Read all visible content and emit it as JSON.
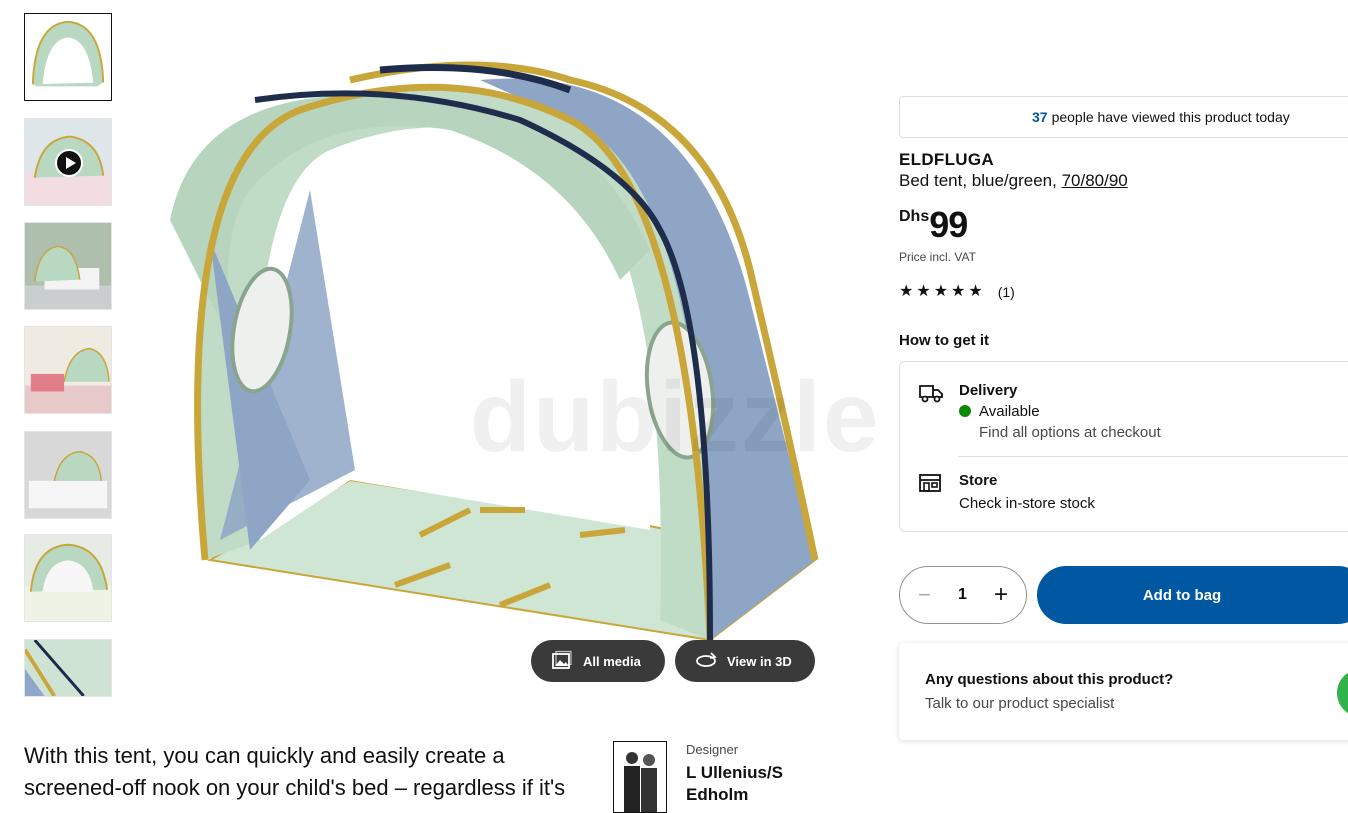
{
  "thumbnails": [
    {
      "label": "Tent product shot",
      "active": true
    },
    {
      "label": "Video",
      "video": true
    },
    {
      "label": "Bedroom scene"
    },
    {
      "label": "Child room"
    },
    {
      "label": "Bunk bed scene"
    },
    {
      "label": "Tent on bed"
    },
    {
      "label": "Detail"
    }
  ],
  "media": {
    "watermark": "dubizzle",
    "all_media_label": "All media",
    "view_3d_label": "View in 3D"
  },
  "description": "With this tent, you can quickly and easily create a screened-off nook on your child's bed – regardless if it's",
  "designer": {
    "label": "Designer",
    "name": "L Ullenius/S Edholm"
  },
  "viewers": {
    "count": "37",
    "text": "people have viewed this product today"
  },
  "product": {
    "name": "ELDFLUGA",
    "description": "Bed tent, blue/green,",
    "size": "70/80/90",
    "currency": "Dhs",
    "price": "99",
    "price_note": "Price incl. VAT",
    "rating_count": "(1)",
    "rating_value": 5
  },
  "how_to_get": {
    "title": "How to get it",
    "delivery_title": "Delivery",
    "delivery_status": "Available",
    "delivery_note": "Find all options at checkout",
    "store_title": "Store",
    "store_note": "Check in-store stock"
  },
  "cart": {
    "quantity": "1",
    "minus": "−",
    "plus": "+",
    "add_label": "Add to bag"
  },
  "questions": {
    "title": "Any questions about this product?",
    "subtitle": "Talk to our product specialist"
  },
  "colors": {
    "brand_blue": "#0058a3",
    "available_green": "#0a8a00"
  }
}
